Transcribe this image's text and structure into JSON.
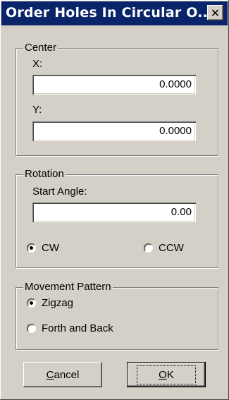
{
  "dialog": {
    "title": "Order Holes In Circular O...",
    "close_symbol": "✕"
  },
  "center": {
    "group_label": "Center",
    "x_label": "X:",
    "x_value": "0.0000",
    "y_label": "Y:",
    "y_value": "0.0000"
  },
  "rotation": {
    "group_label": "Rotation",
    "start_angle_label": "Start Angle:",
    "start_angle_value": "0.00",
    "options": [
      {
        "label": "CW",
        "checked": true
      },
      {
        "label": "CCW",
        "checked": false
      }
    ]
  },
  "movement": {
    "group_label": "Movement Pattern",
    "options": [
      {
        "label": "Zigzag",
        "checked": true
      },
      {
        "label": "Forth and Back",
        "checked": false
      }
    ]
  },
  "buttons": {
    "cancel_first": "C",
    "cancel_rest": "ancel",
    "ok_first": "O",
    "ok_rest": "K"
  }
}
